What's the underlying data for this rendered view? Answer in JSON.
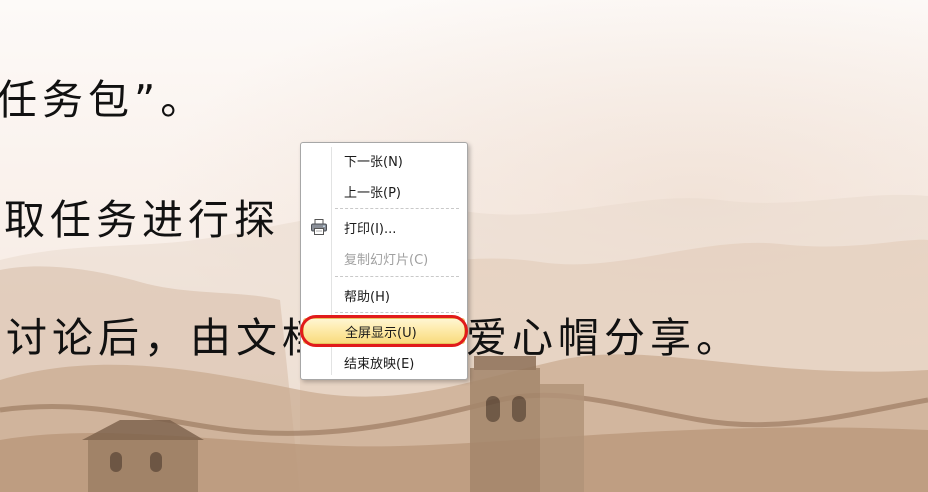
{
  "slide": {
    "line1": "任务包”。",
    "line2": "取任务进行探",
    "line3": "讨论后，由文档者带上爱心帽分享。"
  },
  "context_menu": {
    "items": [
      {
        "label": "下一张(N)",
        "enabled": true
      },
      {
        "label": "上一张(P)",
        "enabled": true
      },
      {
        "label": "打印(I)...",
        "enabled": true,
        "icon": "printer-icon"
      },
      {
        "label": "复制幻灯片(C)",
        "enabled": false
      },
      {
        "label": "帮助(H)",
        "enabled": true
      },
      {
        "label": "全屏显示(U)",
        "enabled": true,
        "highlighted": true
      },
      {
        "label": "结束放映(E)",
        "enabled": true
      }
    ]
  },
  "colors": {
    "annotation_ring": "#e11b1b",
    "highlight": "#fde9a6"
  }
}
